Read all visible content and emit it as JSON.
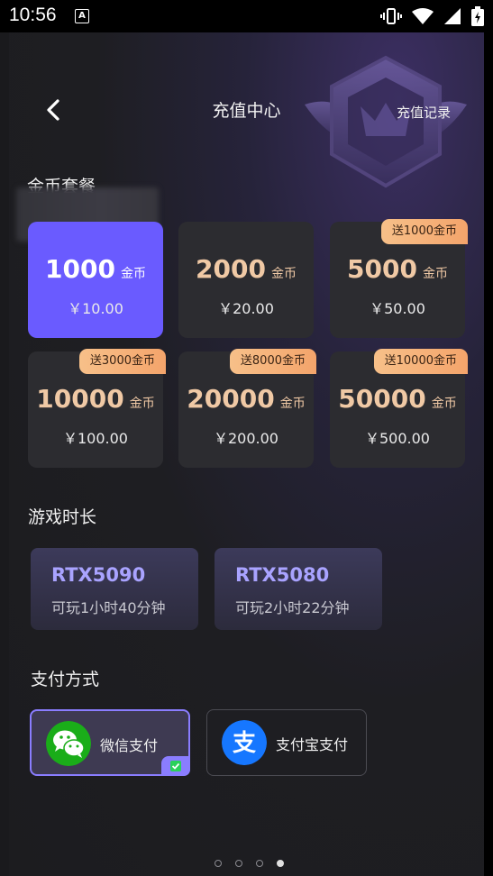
{
  "status_bar": {
    "time": "10:56",
    "notification_icon": "A"
  },
  "header": {
    "title": "充值中心",
    "history_label": "充值记录"
  },
  "coin_packages": {
    "section_title": "金币套餐",
    "unit_label": "金币",
    "items": [
      {
        "amount": "1000",
        "price": "￥10.00",
        "bonus": "",
        "selected": true
      },
      {
        "amount": "2000",
        "price": "￥20.00",
        "bonus": "",
        "selected": false
      },
      {
        "amount": "5000",
        "price": "￥50.00",
        "bonus": "送1000金币",
        "selected": false
      },
      {
        "amount": "10000",
        "price": "￥100.00",
        "bonus": "送3000金币",
        "selected": false
      },
      {
        "amount": "20000",
        "price": "￥200.00",
        "bonus": "送8000金币",
        "selected": false
      },
      {
        "amount": "50000",
        "price": "￥500.00",
        "bonus": "送10000金币",
        "selected": false
      }
    ]
  },
  "game_time": {
    "section_title": "游戏时长",
    "items": [
      {
        "name": "RTX5090",
        "desc": "可玩1小时40分钟"
      },
      {
        "name": "RTX5080",
        "desc": "可玩2小时22分钟"
      }
    ]
  },
  "payment": {
    "section_title": "支付方式",
    "methods": [
      {
        "label": "微信支付",
        "icon": "wechat-icon",
        "selected": true
      },
      {
        "label": "支付宝支付",
        "icon": "alipay-icon",
        "selected": false
      }
    ]
  },
  "pager": {
    "count": 4,
    "active_index": 3
  },
  "colors": {
    "accent": "#6a5bff",
    "gold_text": "#f0c9a5",
    "bonus_badge": "#f4a46b",
    "wechat_green": "#1aad19",
    "alipay_blue": "#1677ff"
  }
}
